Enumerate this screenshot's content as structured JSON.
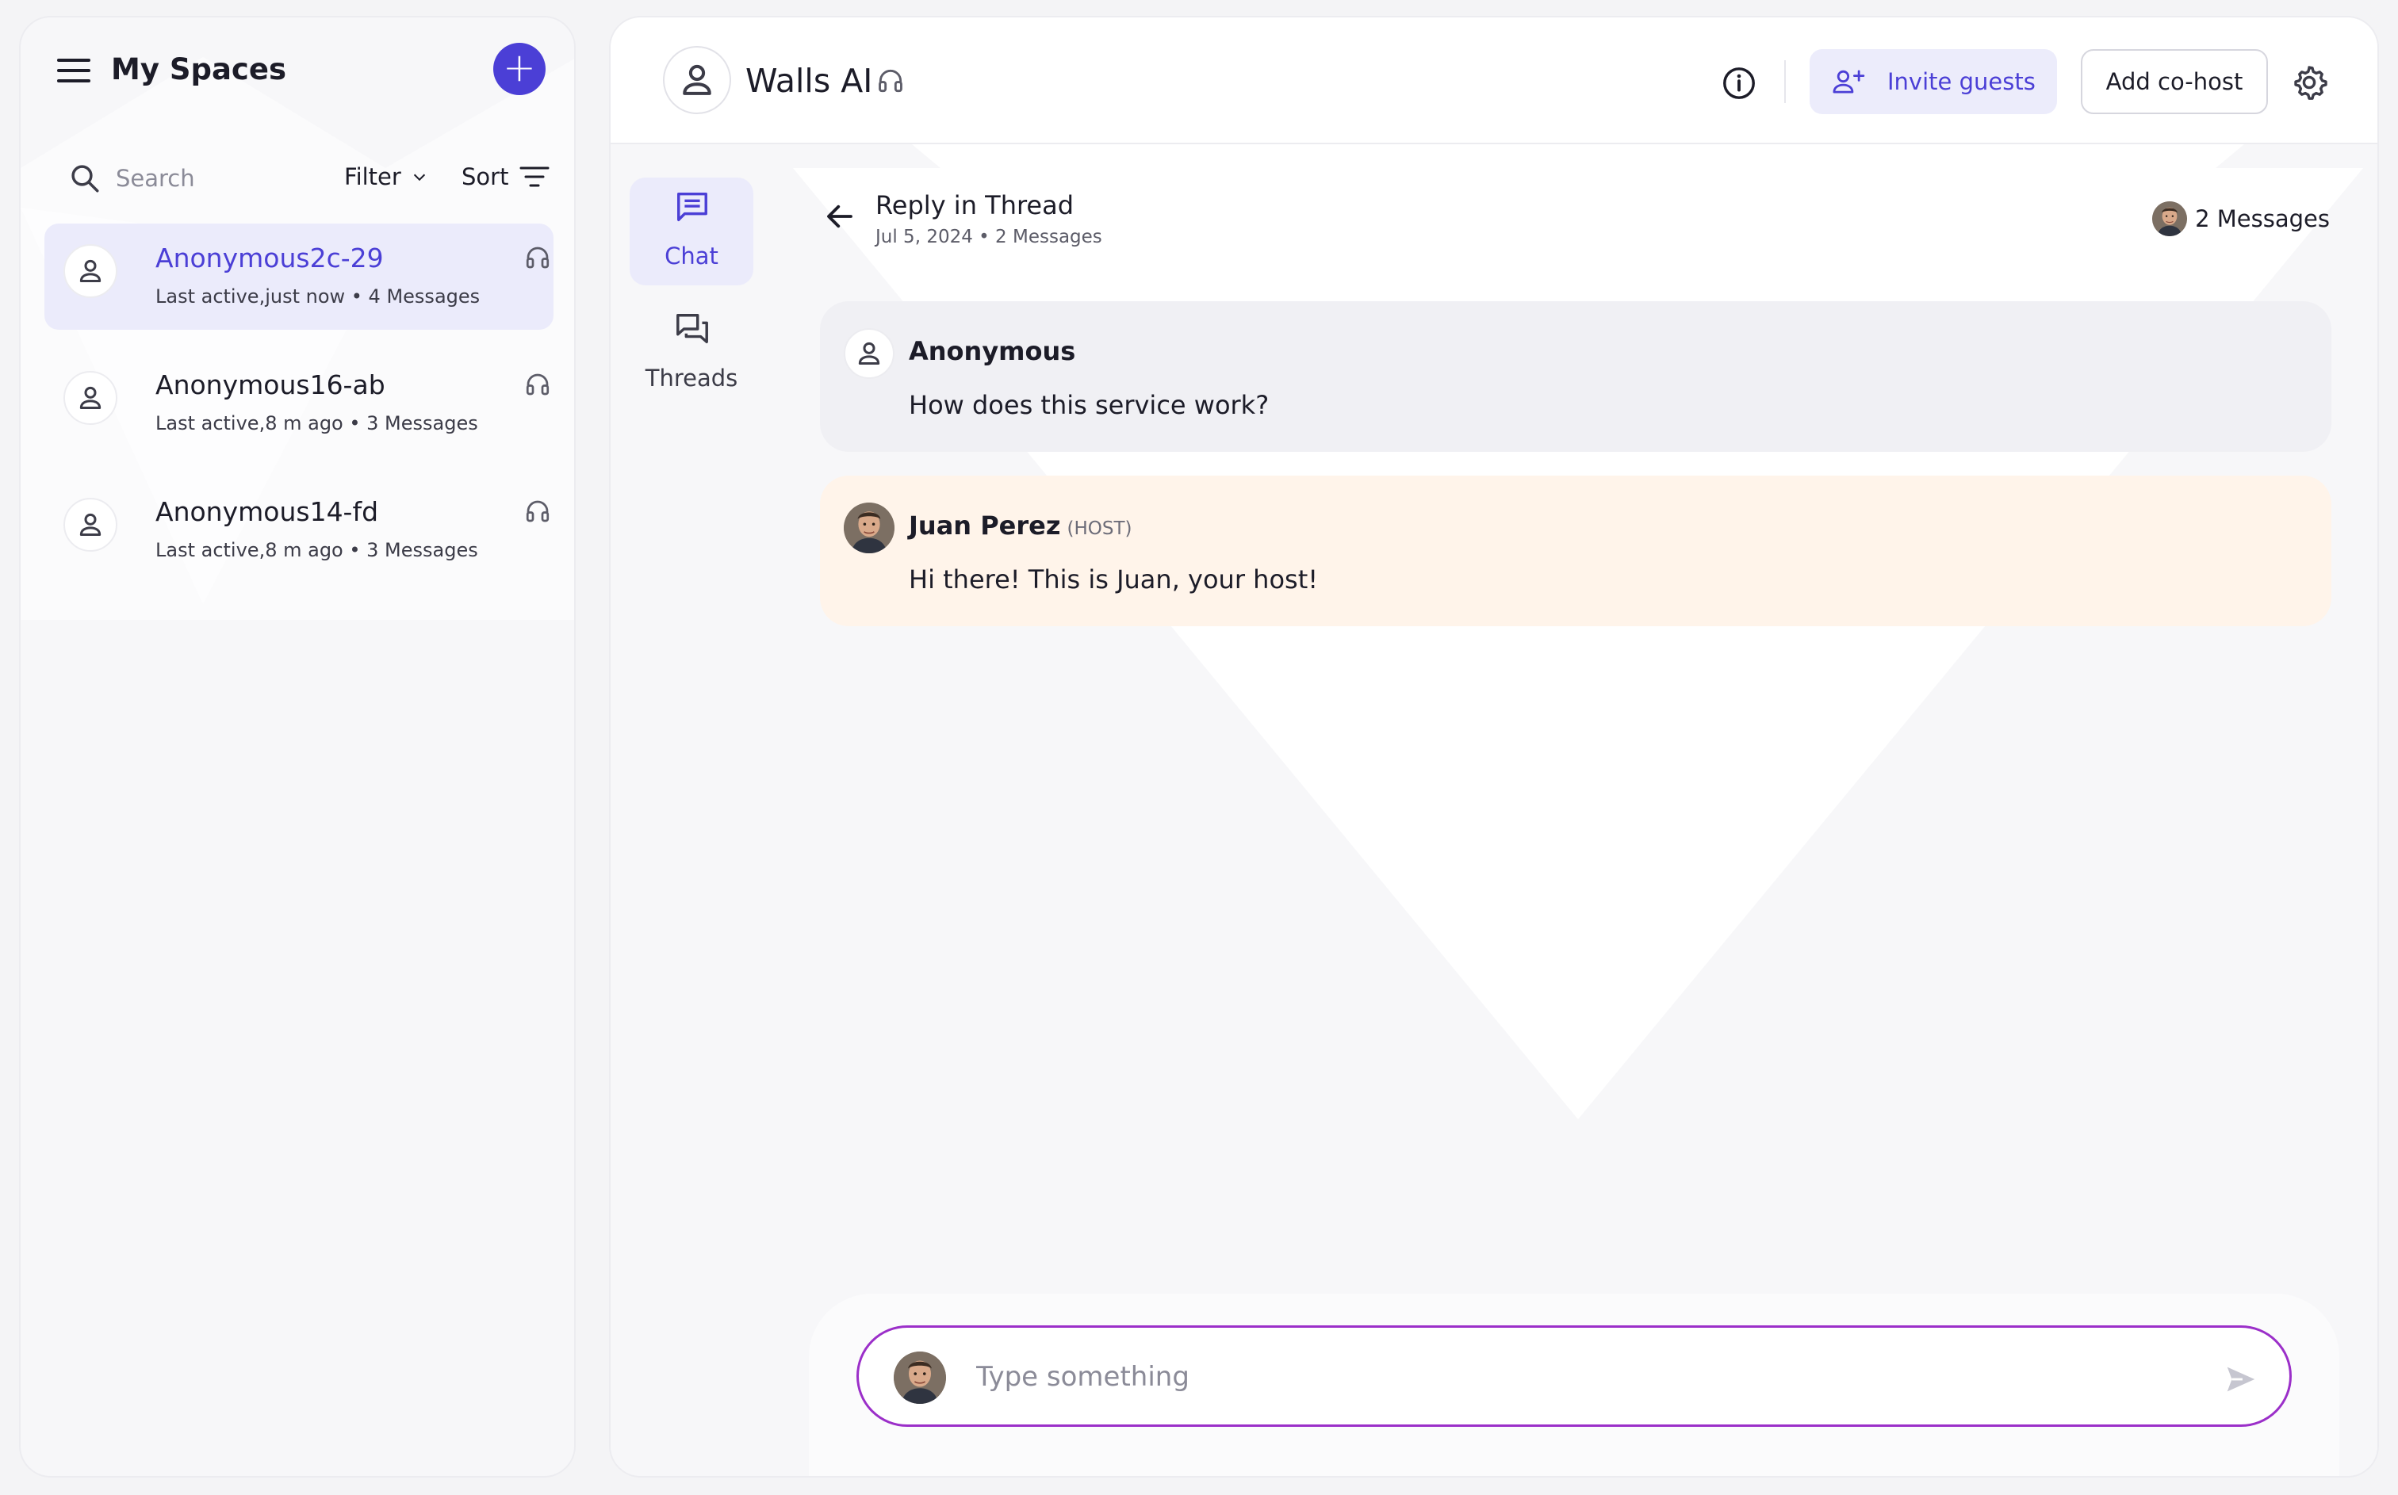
{
  "left_panel": {
    "title": "My Spaces",
    "search_placeholder": "Search",
    "filter_label": "Filter",
    "sort_label": "Sort",
    "conversations": [
      {
        "name": "Anonymous2c-29",
        "meta": "Last active,just now • 4 Messages",
        "active": true
      },
      {
        "name": "Anonymous16-ab",
        "meta": "Last active,8 m ago • 3 Messages",
        "active": false
      },
      {
        "name": "Anonymous14-fd",
        "meta": "Last active,8 m ago • 3 Messages",
        "active": false
      }
    ]
  },
  "header": {
    "space_title": "Walls AI",
    "invite_label": "Invite guests",
    "cohost_label": "Add co-host"
  },
  "side_tabs": [
    {
      "label": "Chat",
      "active": true
    },
    {
      "label": "Threads",
      "active": false
    }
  ],
  "thread": {
    "title": "Reply in Thread",
    "subtitle": "Jul 5, 2024 • 2 Messages",
    "count_label": "2 Messages"
  },
  "messages": [
    {
      "author": "Anonymous",
      "role": "",
      "text": "How does this service work?"
    },
    {
      "author": "Juan Perez",
      "role": "(HOST)",
      "text": "Hi there! This is Juan, your host!"
    }
  ],
  "composer": {
    "placeholder": "Type something"
  },
  "colors": {
    "accent": "#4b3fd6",
    "accent_bg": "#ebebfb",
    "host_bubble": "#fff4ea",
    "guest_bubble": "#f0f0f4",
    "composer_border": "#9b2fc9"
  }
}
